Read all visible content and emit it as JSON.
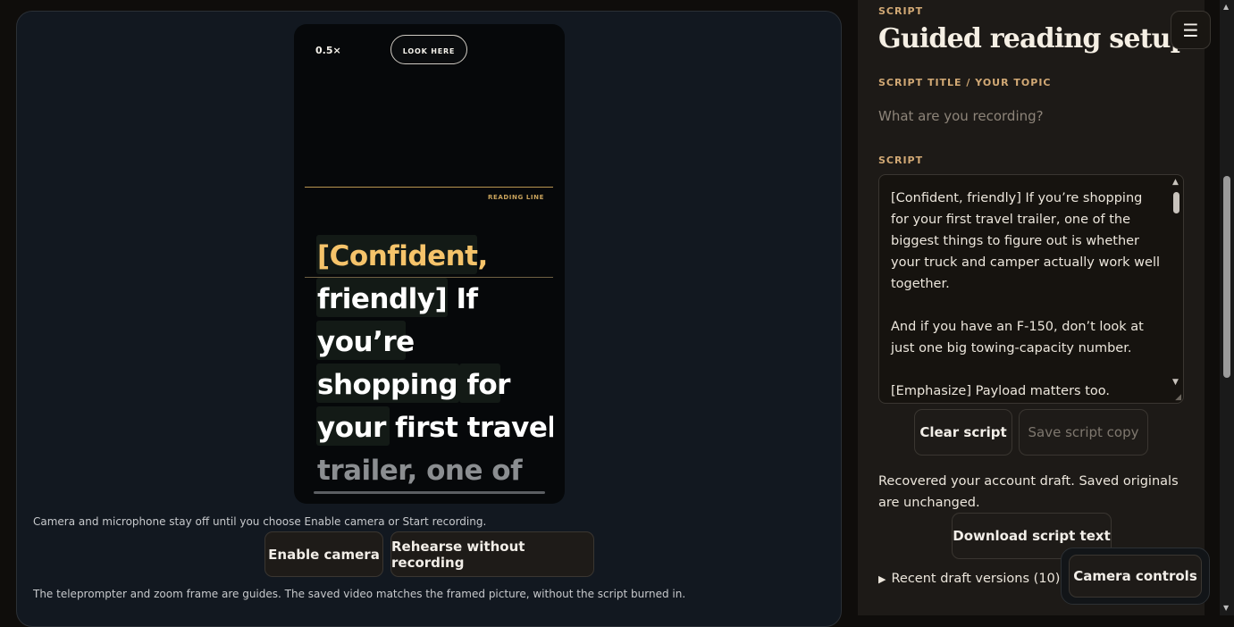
{
  "stage": {
    "zoom_level": "0.5×",
    "look_here_label": "LOOK HERE",
    "reading_line_label": "READING LINE",
    "prompter_lines": [
      "[Confident,",
      "friendly] If",
      "you’re",
      "shopping for",
      "your first travel",
      "trailer, one of"
    ],
    "camera_note": "Camera and microphone stay off until you choose Enable camera or Start recording.",
    "enable_camera_label": "Enable camera",
    "rehearse_label": "Rehearse without recording",
    "guide_note": "The teleprompter and zoom frame are guides. The saved video matches the framed picture, without the script burned in."
  },
  "panel": {
    "eyebrow": "SCRIPT",
    "title": "Guided reading setup",
    "title_field_label": "SCRIPT TITLE / YOUR TOPIC",
    "title_field_placeholder": "What are you recording?",
    "script_label": "SCRIPT",
    "script_text": "[Confident, friendly] If you’re shopping for your first travel trailer, one of the biggest things to figure out is whether your truck and camper actually work well together.\n\nAnd if you have an F-150, don’t look at just one big towing-capacity number.\n\n[Emphasize] Payload matters too.",
    "clear_script_label": "Clear script",
    "save_copy_label": "Save script copy",
    "status_message": "Recovered your account draft. Saved originals are unchanged.",
    "download_label": "Download script text",
    "recent_drafts_label": "Recent draft versions (10)",
    "camera_controls_label": "Camera controls"
  },
  "colors": {
    "accent_gold": "#f5c36a",
    "eyebrow_tan": "#d2a975",
    "panel_bg": "#1d1a17",
    "stage_bg": "#121820"
  }
}
